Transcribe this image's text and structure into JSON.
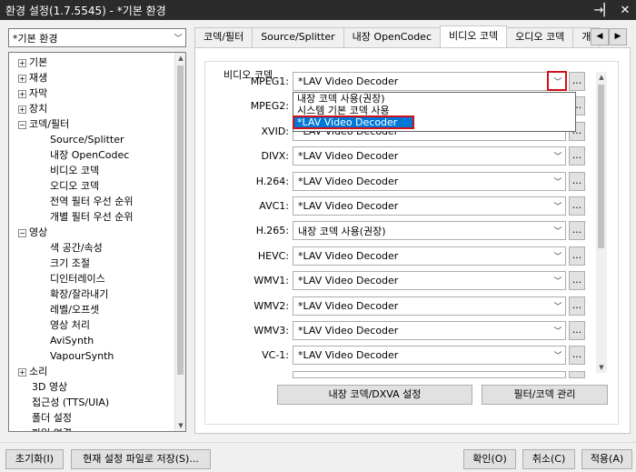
{
  "window": {
    "title": "환경 설정(1.7.5545) - *기본 환경",
    "pin_icon": "pin-icon",
    "close_icon": "close-icon"
  },
  "preset": {
    "value": "*기본 환경"
  },
  "tree": {
    "items": [
      {
        "label": "기본",
        "expander": "+",
        "level": 0
      },
      {
        "label": "재생",
        "expander": "+",
        "level": 0
      },
      {
        "label": "자막",
        "expander": "+",
        "level": 0
      },
      {
        "label": "장치",
        "expander": "+",
        "level": 0
      },
      {
        "label": "코덱/필터",
        "expander": "−",
        "level": 0
      },
      {
        "label": "Source/Splitter",
        "expander": "",
        "level": 1
      },
      {
        "label": "내장 OpenCodec",
        "expander": "",
        "level": 1
      },
      {
        "label": "비디오 코덱",
        "expander": "",
        "level": 1
      },
      {
        "label": "오디오 코덱",
        "expander": "",
        "level": 1
      },
      {
        "label": "전역 필터 우선 순위",
        "expander": "",
        "level": 1
      },
      {
        "label": "개별 필터 우선 순위",
        "expander": "",
        "level": 1
      },
      {
        "label": "영상",
        "expander": "−",
        "level": 0
      },
      {
        "label": "색 공간/속성",
        "expander": "",
        "level": 1
      },
      {
        "label": "크기 조절",
        "expander": "",
        "level": 1
      },
      {
        "label": "디인터레이스",
        "expander": "",
        "level": 1
      },
      {
        "label": "확장/잘라내기",
        "expander": "",
        "level": 1
      },
      {
        "label": "레벨/오프셋",
        "expander": "",
        "level": 1
      },
      {
        "label": "영상 처리",
        "expander": "",
        "level": 1
      },
      {
        "label": "AviSynth",
        "expander": "",
        "level": 1
      },
      {
        "label": "VapourSynth",
        "expander": "",
        "level": 1
      },
      {
        "label": "소리",
        "expander": "+",
        "level": 0
      },
      {
        "label": "3D 영상",
        "expander": "",
        "level": 0
      },
      {
        "label": "접근성 (TTS/UIA)",
        "expander": "",
        "level": 0
      },
      {
        "label": "폴더 설정",
        "expander": "",
        "level": 0
      },
      {
        "label": "파일 연결",
        "expander": "",
        "level": 0
      }
    ]
  },
  "tabs": [
    {
      "label": "코덱/필터",
      "active": false
    },
    {
      "label": "Source/Splitter",
      "active": false
    },
    {
      "label": "내장 OpenCodec",
      "active": false
    },
    {
      "label": "비디오 코덱",
      "active": true
    },
    {
      "label": "오디오 코덱",
      "active": false
    },
    {
      "label": "개",
      "active": false
    }
  ],
  "group": {
    "title": "비디오 코덱"
  },
  "rows": [
    {
      "label": "MPEG1:",
      "value": "*LAV Video Decoder"
    },
    {
      "label": "MPEG2:",
      "value": "*LAV Video Decoder"
    },
    {
      "label": "XVID:",
      "value": "*LAV Video Decoder"
    },
    {
      "label": "DIVX:",
      "value": "*LAV Video Decoder"
    },
    {
      "label": "H.264:",
      "value": "*LAV Video Decoder"
    },
    {
      "label": "AVC1:",
      "value": "*LAV Video Decoder"
    },
    {
      "label": "H.265:",
      "value": "내장 코덱 사용(권장)"
    },
    {
      "label": "HEVC:",
      "value": "*LAV Video Decoder"
    },
    {
      "label": "WMV1:",
      "value": "*LAV Video Decoder"
    },
    {
      "label": "WMV2:",
      "value": "*LAV Video Decoder"
    },
    {
      "label": "WMV3:",
      "value": "*LAV Video Decoder"
    },
    {
      "label": "VC-1:",
      "value": "*LAV Video Decoder"
    },
    {
      "label": "",
      "value": ""
    }
  ],
  "dots_label": "...",
  "dropdown": {
    "options": [
      {
        "label": "내장 코덱 사용(권장)",
        "selected": false
      },
      {
        "label": "시스템 기본 코덱 사용",
        "selected": false
      },
      {
        "label": "*LAV Video Decoder",
        "selected": true
      }
    ]
  },
  "panel_buttons": {
    "internal": "내장 코덱/DXVA 설정",
    "manage": "필터/코덱 관리"
  },
  "footer": {
    "reset": "초기화(I)",
    "save": "현재 설정 파일로 저장(S)...",
    "ok": "확인(O)",
    "cancel": "취소(C)",
    "apply": "적용(A)"
  }
}
